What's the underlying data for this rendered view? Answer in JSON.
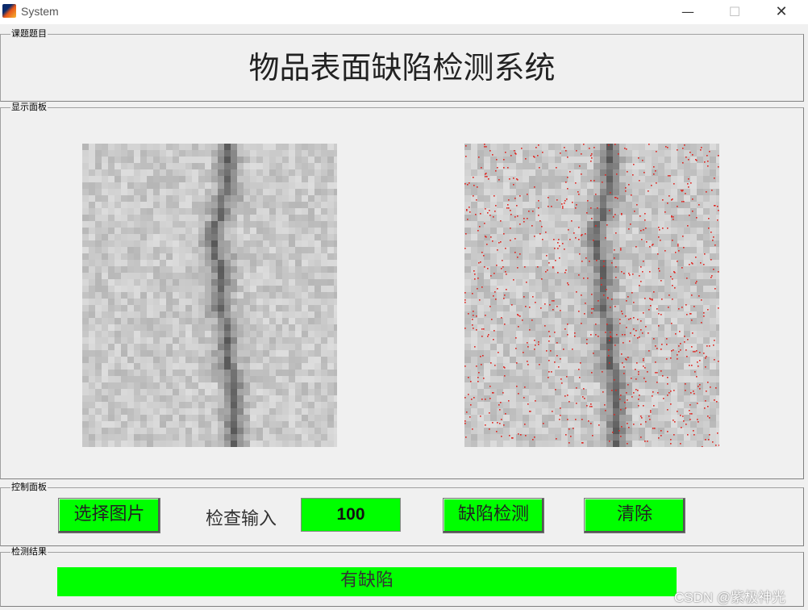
{
  "window": {
    "title": "System",
    "minimize_glyph": "—",
    "maximize_glyph": "☐",
    "close_glyph": "✕"
  },
  "panels": {
    "title_panel": {
      "label": "课题题目",
      "heading": "物品表面缺陷检测系统"
    },
    "display_panel": {
      "label": "显示面板"
    },
    "control_panel": {
      "label": "控制面板",
      "select_button": "选择图片",
      "check_label": "检查输入",
      "check_value": "100",
      "detect_button": "缺陷检测",
      "clear_button": "清除"
    },
    "result_panel": {
      "label": "检测结果",
      "result_text": "有缺陷"
    }
  },
  "colors": {
    "button_green": "#00ff00",
    "defect_mark": "#e0241f"
  },
  "watermark": "CSDN @紫极神光"
}
